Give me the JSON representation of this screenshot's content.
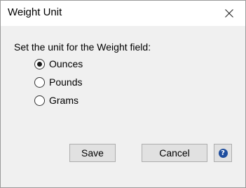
{
  "window": {
    "title": "Weight Unit"
  },
  "prompt": "Set the unit for the Weight field:",
  "options": [
    {
      "label": "Ounces",
      "checked": true
    },
    {
      "label": "Pounds",
      "checked": false
    },
    {
      "label": "Grams",
      "checked": false
    }
  ],
  "buttons": {
    "save_label": "Save",
    "cancel_label": "Cancel",
    "help_glyph": "?"
  },
  "icons": {
    "close": "close-icon",
    "help": "help-icon"
  },
  "colors": {
    "help_icon": "#1f4e9e",
    "dialog_background": "#f0f0f0",
    "titlebar_background": "#ffffff"
  }
}
